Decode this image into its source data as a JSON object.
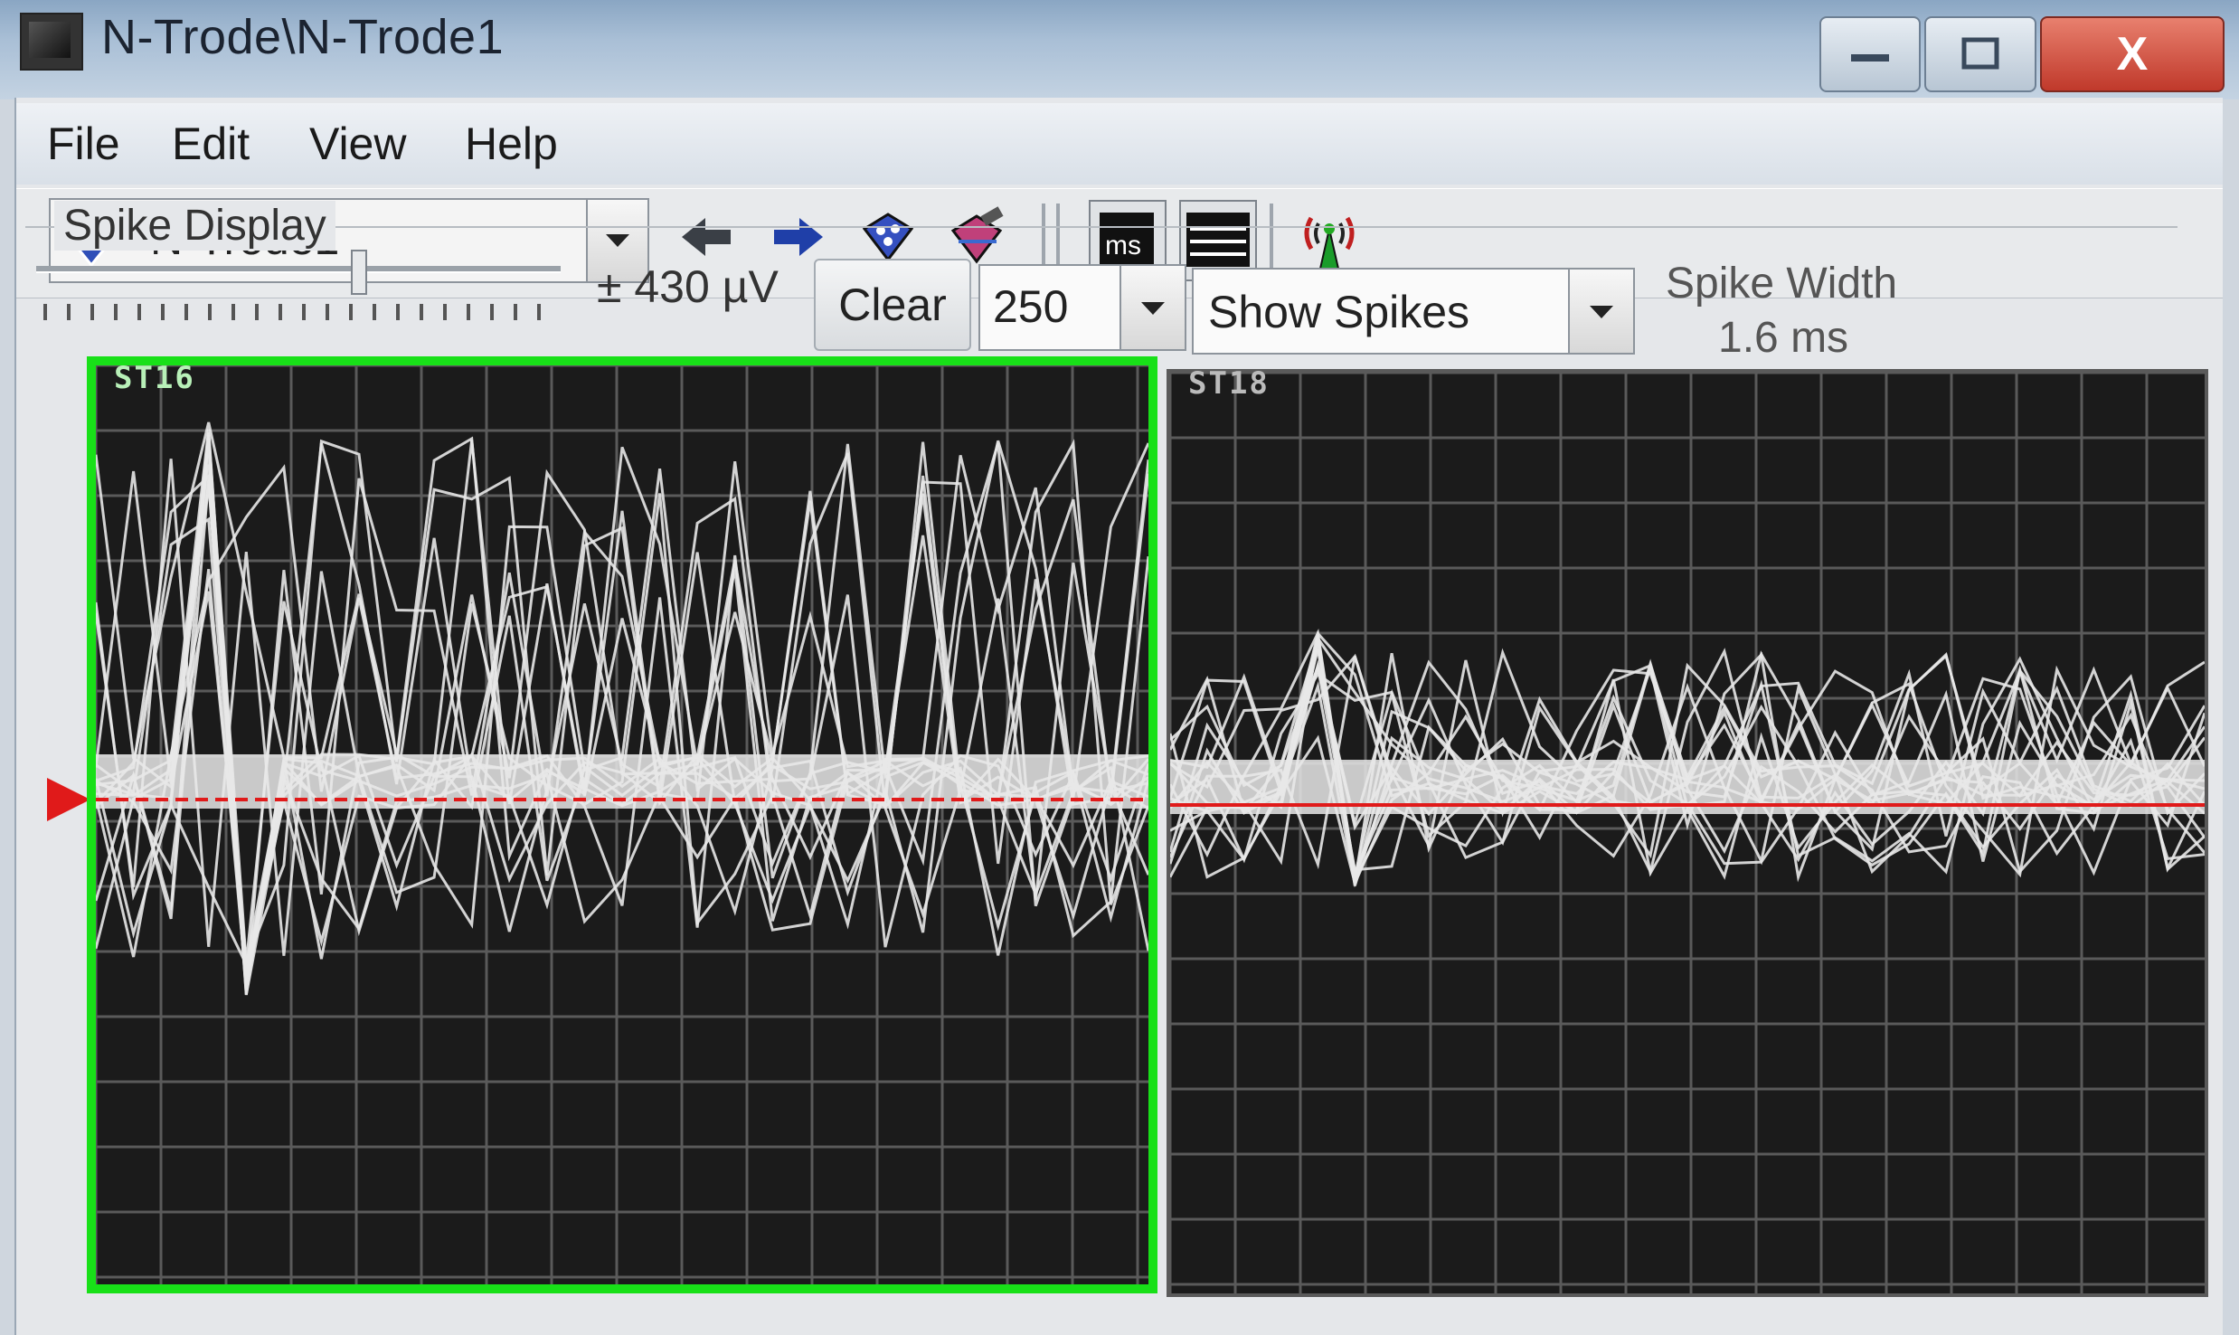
{
  "window": {
    "title": "N-Trode\\N-Trode1",
    "close_label": "X"
  },
  "menu": [
    "File",
    "Edit",
    "View",
    "Help"
  ],
  "toolbar": {
    "ntrode_selected": "N-Trode1",
    "icons": [
      "ntrode-icon",
      "back-arrow-icon",
      "forward-arrow-icon",
      "shield-icon",
      "shield-edit-icon",
      "ms-icon",
      "channels-icon",
      "antenna-icon"
    ],
    "ms_label": "ms"
  },
  "spike_display": {
    "group_label": "Spike Display",
    "range_label": "± 430 µV",
    "range_fraction": 0.58,
    "clear_label": "Clear",
    "spike_count": "250",
    "mode": "Show Spikes",
    "spike_width_label": "Spike Width",
    "spike_width_value": "1.6 ms"
  },
  "panels": [
    {
      "label": "ST16",
      "selected": true
    },
    {
      "label": "ST18",
      "selected": false
    }
  ],
  "colors": {
    "selected_border": "#18e018",
    "threshold_line": "#e01a1a",
    "waveform": "#e8e8e8",
    "grid": "#5a5a5a",
    "panel_bg": "#1b1b1b"
  }
}
